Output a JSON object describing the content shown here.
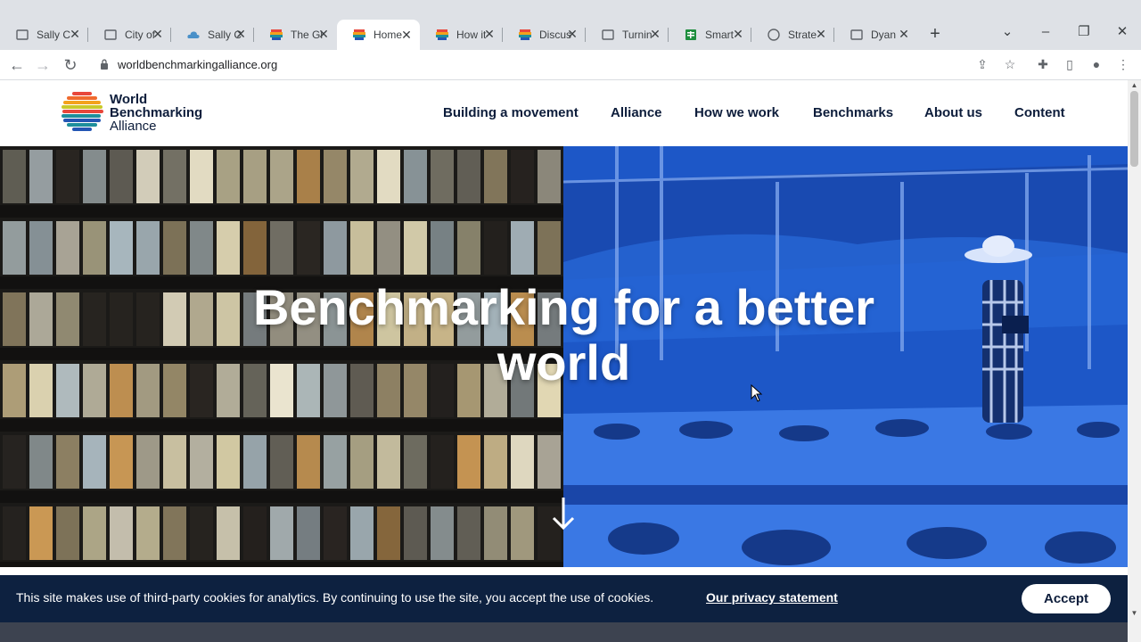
{
  "browser": {
    "tabs": [
      {
        "title": "Sally C",
        "favicon": "page-icon",
        "active": false
      },
      {
        "title": "City of",
        "favicon": "page-icon",
        "active": false
      },
      {
        "title": "Sally C",
        "favicon": "cloud-icon",
        "active": false
      },
      {
        "title": "The Gl",
        "favicon": "wba-logo-icon",
        "active": false
      },
      {
        "title": "Home",
        "favicon": "wba-logo-icon",
        "active": true
      },
      {
        "title": "How it",
        "favicon": "wba-logo-icon",
        "active": false
      },
      {
        "title": "Discus",
        "favicon": "wba-logo-icon",
        "active": false
      },
      {
        "title": "Turnin",
        "favicon": "page-icon",
        "active": false
      },
      {
        "title": "Smart",
        "favicon": "sheet-icon",
        "active": false
      },
      {
        "title": "Strate",
        "favicon": "page-icon",
        "active": false
      },
      {
        "title": "Dyan",
        "favicon": "page-icon",
        "active": false
      }
    ],
    "url": "worldbenchmarkingalliance.org"
  },
  "site": {
    "logo": {
      "line1": "World",
      "line2": "Benchmarking",
      "line3": "Alliance"
    },
    "nav": [
      "Building a movement",
      "Alliance",
      "How we work",
      "Benchmarks",
      "About us",
      "Content"
    ],
    "hero": {
      "title_line1": "Benchmarking for a better",
      "title_line2": "world"
    },
    "cookie": {
      "text": "This site makes use of third-party cookies for analytics. By continuing to use the site, you accept the use of cookies.",
      "link": "Our privacy statement",
      "accept": "Accept"
    }
  },
  "colors": {
    "nav_text": "#0d1d3b",
    "cookie_bg": "#0d2140",
    "hero_blue": "#1d57c7",
    "tab_strip": "#dee1e6"
  }
}
